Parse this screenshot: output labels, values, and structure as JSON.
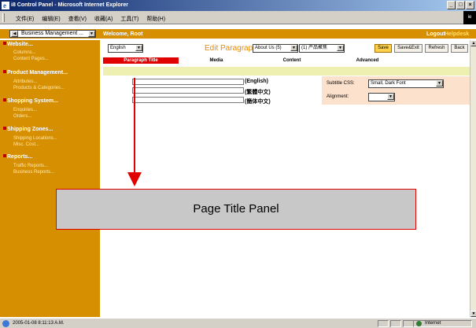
{
  "window": {
    "title": "i8 Control Panel - Microsoft Internet Explorer",
    "minimize": "_",
    "restore": "□",
    "close": "×"
  },
  "menu": {
    "items": [
      "文件(E)",
      "编辑(E)",
      "查看(V)",
      "收藏(A)",
      "工具(T)",
      "帮助(H)"
    ],
    "logo_text": "ie"
  },
  "header": {
    "module_select": "Business Management ...",
    "welcome": "Welcome, Root",
    "logout": "Logout",
    "helpdesk": "Helpdesk"
  },
  "sidebar": {
    "sections": [
      {
        "title": "Website...",
        "items": [
          "Columns...",
          "Content Pages..."
        ]
      },
      {
        "title": "Product Management...",
        "items": [
          "Attributes...",
          "Products & Categories..."
        ]
      },
      {
        "title": "Shopping System...",
        "items": [
          "Enquiries...",
          "Orders..."
        ]
      },
      {
        "title": "Shipping Zones...",
        "items": [
          "Shipping Locations...",
          "Misc. Cost..."
        ]
      },
      {
        "title": "Reports...",
        "items": [
          "Traffic Reports...",
          "Business Reports..."
        ]
      }
    ]
  },
  "toolbar": {
    "language": "English",
    "edit_title": "Edit Paragraph:",
    "page_select": "About Us (5)",
    "paragraph_select": "(1) 产品聚焦",
    "save": "Save",
    "save_exit": "Save&Exit",
    "refresh": "Refresh",
    "back": "Back"
  },
  "tabs": [
    "Paragraph Title",
    "Media",
    "Content",
    "Advanced"
  ],
  "title_panel": {
    "fields": [
      {
        "label": "(English)",
        "value": ""
      },
      {
        "label": "(繁體中文)",
        "value": ""
      },
      {
        "label": "(簡体中文)",
        "value": ""
      }
    ],
    "subtitle_css_label": "Subtitle CSS:",
    "subtitle_css_value": "Small, Dark Font",
    "alignment_label": "Alignment:",
    "alignment_value": ""
  },
  "annotation": {
    "callout": "Page Title Panel",
    "color": "#e00000"
  },
  "statusbar": {
    "text": "2005-01-08 8:11:13 A.M.",
    "zone": "Internet"
  },
  "colors": {
    "sidebar": "#d68f00",
    "active_tab": "#e00000",
    "heading": "#e68a00"
  }
}
